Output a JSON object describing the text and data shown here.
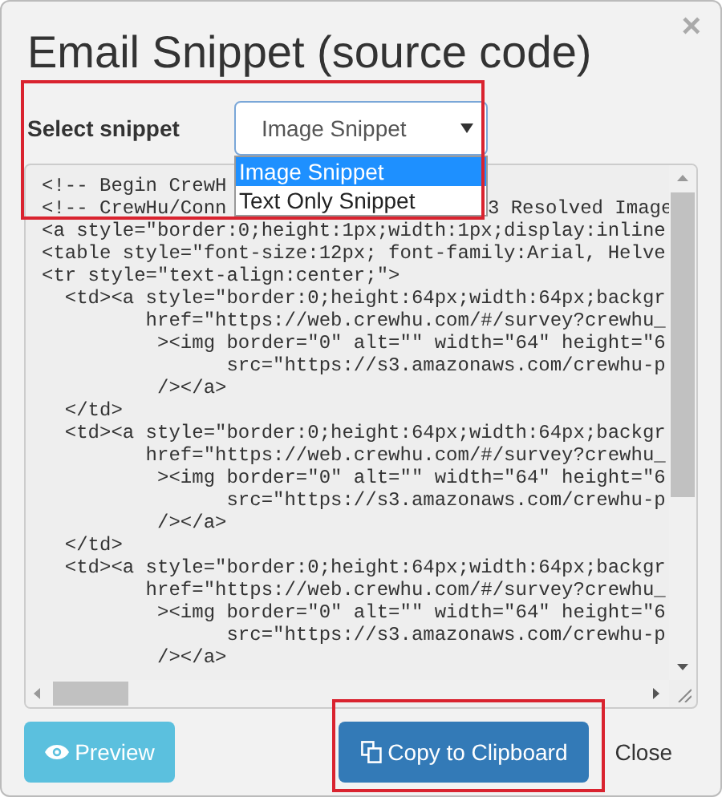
{
  "dialog": {
    "title": "Email Snippet (source code)",
    "close_icon": "×"
  },
  "snippet_select": {
    "label": "Select snippet",
    "value": "Image Snippet",
    "expanded": true,
    "options": [
      {
        "label": "Image Snippet",
        "selected": true
      },
      {
        "label": "Text Only Snippet",
        "selected": false
      }
    ]
  },
  "code_lines": [
    [
      "<!-- Begin CrewH"
    ],
    [
      "<!-- CrewHu/Conn",
      "3 Resolved Image"
    ],
    [
      "<a style=\"border:0;height:1px;width:1px;display:inline"
    ],
    [
      "<table style=\"font-size:12px; font-family:Arial, Helve"
    ],
    [
      "<tr style=\"text-align:center;\">"
    ],
    [
      "  <td><a style=\"border:0;height:64px;width:64px;backgr"
    ],
    [
      "         href=\"https://web.crewhu.com/#/survey?crewhu_"
    ],
    [
      "          ><img border=\"0\" alt=\"\" width=\"64\" height=\"6"
    ],
    [
      "                src=\"https://s3.amazonaws.com/crewhu-p"
    ],
    [
      "          /></a>"
    ],
    [
      "  </td>"
    ],
    [
      "  <td><a style=\"border:0;height:64px;width:64px;backgr"
    ],
    [
      "         href=\"https://web.crewhu.com/#/survey?crewhu_"
    ],
    [
      "          ><img border=\"0\" alt=\"\" width=\"64\" height=\"6"
    ],
    [
      "                src=\"https://s3.amazonaws.com/crewhu-p"
    ],
    [
      "          /></a>"
    ],
    [
      "  </td>"
    ],
    [
      "  <td><a style=\"border:0;height:64px;width:64px;backgr"
    ],
    [
      "         href=\"https://web.crewhu.com/#/survey?crewhu_"
    ],
    [
      "          ><img border=\"0\" alt=\"\" width=\"64\" height=\"6"
    ],
    [
      "                src=\"https://s3.amazonaws.com/crewhu-p"
    ],
    [
      "          /></a>"
    ]
  ],
  "buttons": [
    {
      "label": "Preview",
      "kind": "preview"
    },
    {
      "label": "Copy to Clipboard",
      "kind": "copy"
    },
    {
      "label": "Close",
      "kind": "link"
    }
  ]
}
